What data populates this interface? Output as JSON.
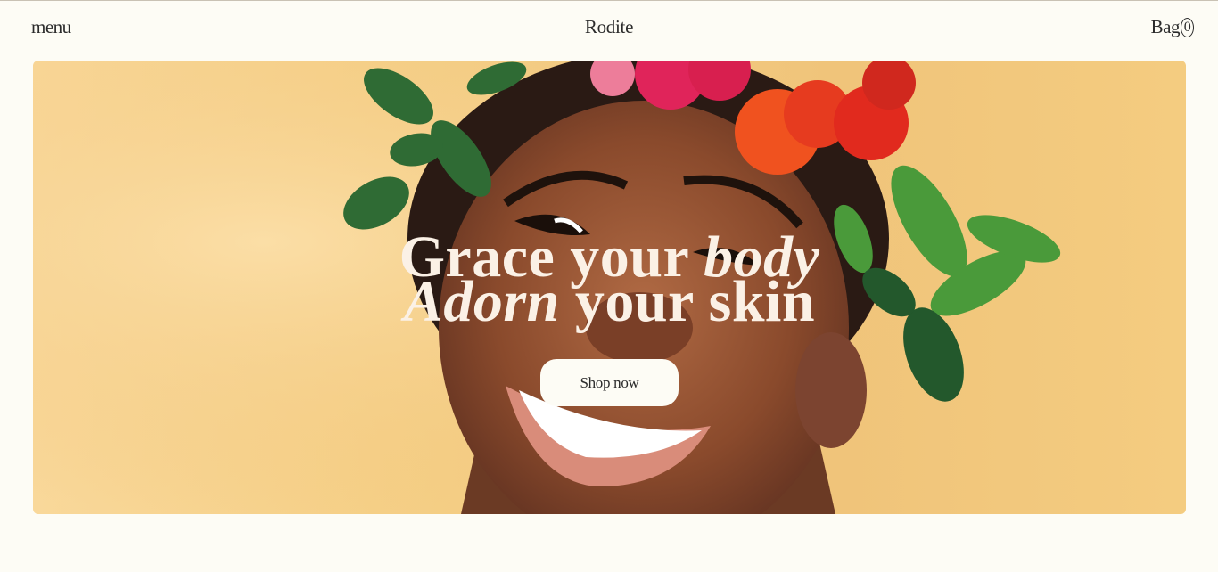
{
  "header": {
    "menu_label": "menu",
    "brand": "Rodite",
    "bag_label": "Bag",
    "bag_count": "0"
  },
  "hero": {
    "headline_line1_a": "Grace your ",
    "headline_line1_b": "body",
    "headline_line2_a": "Adorn",
    "headline_line2_b": " your skin",
    "cta_label": "Shop now",
    "colors": {
      "background": "#f5cf86",
      "headline": "#fbf1e6",
      "page_bg": "#fdfcf5"
    }
  }
}
